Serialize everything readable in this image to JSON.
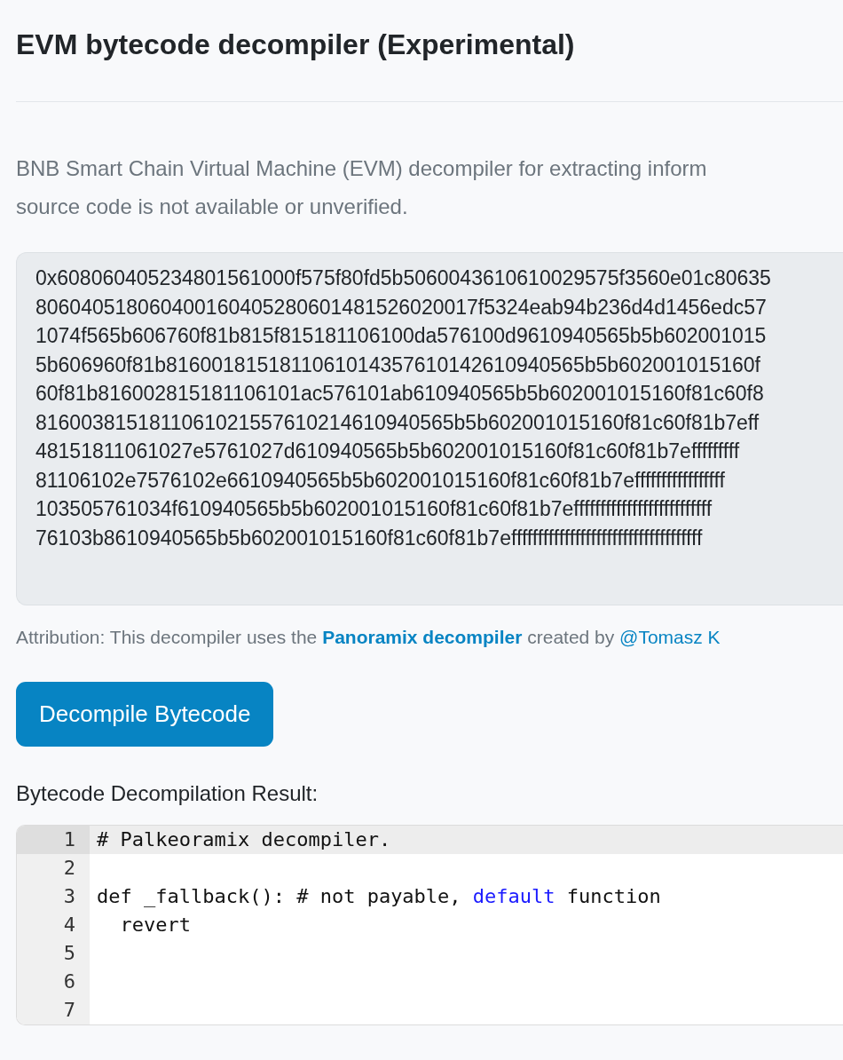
{
  "title": "EVM bytecode decompiler (Experimental)",
  "description": [
    "BNB Smart Chain Virtual Machine (EVM) decompiler for extracting inform",
    "source code is not available or unverified."
  ],
  "bytecode_lines": [
    "0x608060405234801561000f575f80fd5b5060043610610029575f3560e01c80635",
    "806040518060400160405280601481526020017f5324eab94b236d4d1456edc57",
    "1074f565b606760f81b815f815181106100da576100d9610940565b5b602001015",
    "5b606960f81b8160018151811061014357610142610940565b5b602001015160f",
    "60f81b816002815181106101ac576101ab610940565b5b602001015160f81c60f8",
    "8160038151811061021557610214610940565b5b602001015160f81c60f81b7eff",
    "48151811061027e5761027d610940565b5b602001015160f81c60f81b7efffffffff",
    "81106102e7576102e6610940565b5b602001015160f81c60f81b7efffffffffffffffff",
    "103505761034f610940565b5b602001015160f81c60f81b7effffffffffffffffffffffffff",
    "76103b8610940565b5b602001015160f81c60f81b7effffffffffffffffffffffffffffffffffff"
  ],
  "attribution": {
    "before": "Attribution: This decompiler uses the",
    "link": "Panoramix decompiler",
    "middle": "created by",
    "author": "@Tomasz K"
  },
  "button": "Decompile Bytecode",
  "result_label": "Bytecode Decompilation Result:",
  "editor_lines": [
    {
      "number": "1",
      "selected": true,
      "tokens": [
        {
          "kind": "text",
          "text": "# Palkeoramix decompiler."
        }
      ]
    },
    {
      "number": "2",
      "selected": false
    },
    {
      "number": "3",
      "selected": false,
      "tokens": [
        {
          "kind": "text",
          "text": "def _fallback(): # not payable, "
        },
        {
          "kind": "keyword",
          "text": "default"
        },
        {
          "kind": "text",
          "text": " function"
        }
      ]
    },
    {
      "number": "4",
      "selected": false,
      "tokens": [
        {
          "kind": "text",
          "text": "  revert"
        }
      ]
    },
    {
      "number": "5",
      "selected": false
    },
    {
      "number": "6",
      "selected": false
    },
    {
      "number": "7",
      "selected": false
    }
  ]
}
